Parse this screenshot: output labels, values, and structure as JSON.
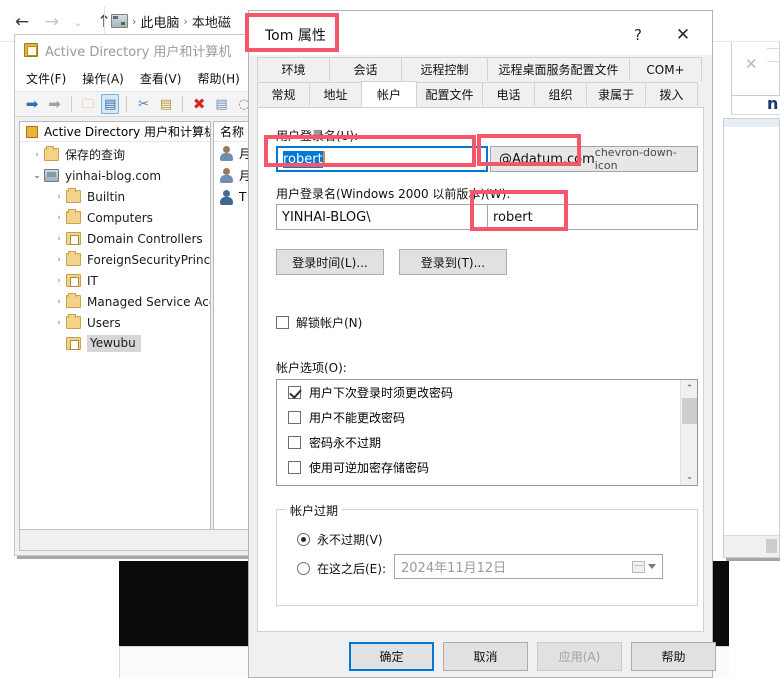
{
  "explorer": {
    "back_icon": "←",
    "forward_icon": "→",
    "recent_icon": "⌄",
    "up_icon": "↑",
    "crumb_drive_icon": "computer-icon",
    "crumb_sep": "›",
    "crumb_items": [
      "此电脑",
      "本地磁"
    ]
  },
  "mmc": {
    "title": "Active Directory 用户和计算机",
    "menu": [
      "文件(F)",
      "操作(A)",
      "查看(V)",
      "帮助(H)"
    ],
    "toolbar_icons": [
      "back-arrow-icon",
      "forward-arrow-icon",
      "up-folder-icon",
      "show-hide-console-tree-icon",
      "cut-icon",
      "paste-icon",
      "delete-icon",
      "properties-icon",
      "refresh-icon"
    ],
    "tree_header": "Active Directory 用户和计算机",
    "list_header": "名称",
    "tree": [
      {
        "label": "保存的查询",
        "icon": "folder-icon",
        "chev": "›",
        "indent": 1,
        "selected": false
      },
      {
        "label": "yinhai-blog.com",
        "icon": "domain-icon",
        "chev": "⌄",
        "indent": 1,
        "selected": false
      },
      {
        "label": "Builtin",
        "icon": "folder-icon",
        "chev": "›",
        "indent": 2,
        "selected": false
      },
      {
        "label": "Computers",
        "icon": "folder-icon",
        "chev": "›",
        "indent": 2,
        "selected": false
      },
      {
        "label": "Domain Controllers",
        "icon": "ou-folder-icon",
        "chev": "›",
        "indent": 2,
        "selected": false
      },
      {
        "label": "ForeignSecurityPrincipa",
        "icon": "folder-icon",
        "chev": "›",
        "indent": 2,
        "selected": false
      },
      {
        "label": "IT",
        "icon": "ou-folder-icon",
        "chev": "›",
        "indent": 2,
        "selected": false
      },
      {
        "label": "Managed Service Acco",
        "icon": "folder-icon",
        "chev": "›",
        "indent": 2,
        "selected": false
      },
      {
        "label": "Users",
        "icon": "folder-icon",
        "chev": "›",
        "indent": 2,
        "selected": false
      },
      {
        "label": "Yewubu",
        "icon": "ou-folder-icon",
        "chev": "",
        "indent": 2,
        "selected": true
      }
    ],
    "list_items": [
      {
        "label": "月",
        "icon": "user-icon"
      },
      {
        "label": "月",
        "icon": "user-icon"
      },
      {
        "label": "T",
        "icon": "user-group-icon"
      }
    ],
    "hscroll_left_icon": "❮",
    "hscroll_right_icon": "❯"
  },
  "dialog": {
    "title": "Tom 属性",
    "help_icon": "?",
    "close_icon": "✕",
    "tabs_row1": [
      "环境",
      "会话",
      "远程控制",
      "远程桌面服务配置文件",
      "COM+"
    ],
    "tabs_row2": [
      "常规",
      "地址",
      "帐户",
      "配置文件",
      "电话",
      "组织",
      "隶属于",
      "拨入"
    ],
    "active_tab": "帐户",
    "account": {
      "logon_name_label": "用户登录名(U):",
      "logon_name_value": "robert",
      "upn_suffix_value": "@Adatum.com",
      "upn_dropdown_icon": "chevron-down-icon",
      "pre2000_label": "用户登录名(Windows 2000 以前版本)(W):",
      "pre2000_domain": "YINHAI-BLOG\\",
      "pre2000_value": "robert",
      "logon_hours_button": "登录时间(L)...",
      "log_on_to_button": "登录到(T)...",
      "unlock_label": "解锁帐户(N)",
      "unlock_checked": false,
      "options_label": "帐户选项(O):",
      "options": [
        {
          "label": "用户下次登录时须更改密码",
          "checked": true
        },
        {
          "label": "用户不能更改密码",
          "checked": false
        },
        {
          "label": "密码永不过期",
          "checked": false
        },
        {
          "label": "使用可逆加密存储密码",
          "checked": false
        }
      ],
      "scroll_up_icon": "⌃",
      "scroll_down_icon": "⌄",
      "expiry_group_title": "帐户过期",
      "expiry_never_label": "永不过期(V)",
      "expiry_never_selected": true,
      "expiry_end_label": "在这之后(E):",
      "expiry_end_selected": false,
      "expiry_date_value": "2024年11月12日",
      "expiry_date_icon": "calendar-icon"
    },
    "footer": {
      "ok": "确定",
      "cancel": "取消",
      "apply": "应用(A)",
      "help": "帮助"
    }
  },
  "background_window": {
    "close_icon": "✕",
    "letter": "n"
  },
  "annotations": {
    "color": "#f4566a",
    "boxes": [
      {
        "name": "title-highlight"
      },
      {
        "name": "logon-name-highlight"
      },
      {
        "name": "upn-suffix-highlight"
      },
      {
        "name": "pre2000-name-highlight"
      }
    ]
  }
}
